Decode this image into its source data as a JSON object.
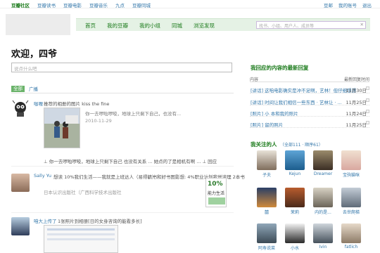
{
  "topnav": {
    "items": [
      "豆瓣社区",
      "豆瓣读书",
      "豆瓣电影",
      "豆瓣音乐",
      "九点",
      "豆瓣同城"
    ],
    "right": [
      "豆邮",
      "我的账号",
      "退出"
    ]
  },
  "mainnav": {
    "tabs": [
      "首页",
      "我的豆瓣",
      "我的小组",
      "同城",
      "浏览发现"
    ],
    "search_placeholder": "找书、小组、用户人、成员等",
    "search_icon": "search-icon"
  },
  "greeting": "欢迎，四爷",
  "say_placeholder": "说点什么吧",
  "feed_tabs": {
    "all": "全部",
    "announce": "广播"
  },
  "feed": [
    {
      "user": "咖喱",
      "action": "推荐的相册的图片 kiss the fine",
      "quote": "你一去啰啦啰唆，地球上只剩下自己，也没有...",
      "date": "2010-11-29",
      "caption": "⊥ 你一去啰啦啰唆，地球上只剩下自己 也没有关系 ... 她点的了是相机有啊 ... ⊥ 回应"
    },
    {
      "user": "Sally Yu",
      "action": "想读 10%我们生活——我就是上班达人（易得精）",
      "action2": "，书和好书图影想: 4%职业计划我觉读理 2本书",
      "sub": "日本认识出版社（广西科学技术出版社",
      "book_title": "10%",
      "book_sub": "能力生活"
    },
    {
      "user": "咱大上传了",
      "action": "1张照片到相册[日的女身咨询的能看多长]"
    }
  ],
  "right": {
    "replies_title": "我回应的内容的最新回复",
    "col_content": "内容",
    "col_time": "最新回复时间",
    "rows": [
      {
        "title": "[讲话] 这咱电影确实是冲不足啊，艺林！但仔细想想",
        "date": "11月30日"
      },
      {
        "title": "[讲话] 时间让我们相信一些东西 · 艺林让 · ...",
        "date": "11月25日"
      },
      {
        "title": "[照片] 小 本和我的照片",
        "date": "11月24日"
      },
      {
        "title": "[照片] 留的照片",
        "date": "11月25日"
      }
    ],
    "follow_title": "我关注的人",
    "follow_count": "（全部111 · 顺序61）",
    "friends": [
      {
        "name": "子夫"
      },
      {
        "name": "Kejun"
      },
      {
        "name": "Dreamer"
      },
      {
        "name": "宝驹猫咪"
      },
      {
        "name": "囍"
      },
      {
        "name": "茉莉"
      },
      {
        "name": "内的是..."
      },
      {
        "name": "去世爬梯"
      },
      {
        "name": "阿寿说菜"
      },
      {
        "name": "小水"
      },
      {
        "name": "Ivin"
      },
      {
        "name": "fatlich"
      }
    ]
  }
}
